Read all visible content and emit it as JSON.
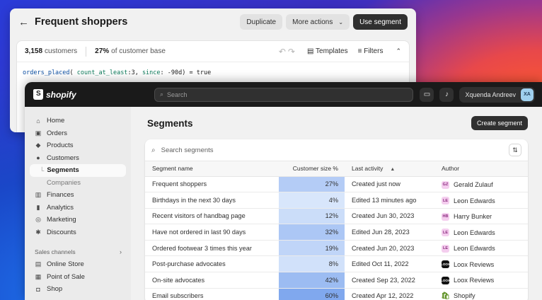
{
  "back_panel": {
    "title": "Frequent shoppers",
    "buttons": {
      "duplicate": "Duplicate",
      "more_actions": "More actions",
      "use_segment": "Use segment"
    },
    "stats": {
      "customers_count": "3,158",
      "customers_label": "customers",
      "percent": "27%",
      "percent_label": "of customer base"
    },
    "tools": {
      "templates": "Templates",
      "filters": "Filters"
    },
    "query": {
      "fn": "orders_placed",
      "arg1_key": "count_at_least",
      "arg1_val": "3",
      "arg2_key": "since",
      "arg2_val": "-90d",
      "op": "=",
      "value": "true"
    }
  },
  "topbar": {
    "brand": "shopify",
    "search_placeholder": "Search",
    "user_name": "Xquenda Andreev",
    "user_initials": "XA"
  },
  "sidebar": {
    "items": [
      {
        "label": "Home",
        "icon": "home-icon",
        "glyph": "⌂"
      },
      {
        "label": "Orders",
        "icon": "orders-icon",
        "glyph": "▣"
      },
      {
        "label": "Products",
        "icon": "tag-icon",
        "glyph": "◆"
      },
      {
        "label": "Customers",
        "icon": "person-icon",
        "glyph": "●"
      }
    ],
    "sub_items": [
      {
        "label": "Segments",
        "active": true
      },
      {
        "label": "Companies",
        "active": false
      }
    ],
    "items2": [
      {
        "label": "Finances",
        "icon": "bank-icon",
        "glyph": "▥"
      },
      {
        "label": "Analytics",
        "icon": "bar-chart-icon",
        "glyph": "▮"
      },
      {
        "label": "Marketing",
        "icon": "target-icon",
        "glyph": "◎"
      },
      {
        "label": "Discounts",
        "icon": "discount-icon",
        "glyph": "✱"
      }
    ],
    "section_label": "Sales channels",
    "channels": [
      {
        "label": "Online Store",
        "icon": "store-icon",
        "glyph": "▤"
      },
      {
        "label": "Point of Sale",
        "icon": "pos-icon",
        "glyph": "▦"
      },
      {
        "label": "Shop",
        "icon": "shop-icon",
        "glyph": "◘"
      }
    ]
  },
  "main": {
    "title": "Segments",
    "create_button": "Create segment",
    "search_placeholder": "Search segments",
    "columns": {
      "name": "Segment name",
      "size": "Customer size %",
      "activity": "Last activity",
      "author": "Author"
    },
    "rows": [
      {
        "name": "Frequent shoppers",
        "size": "27%",
        "size_value": 27,
        "activity": "Created just now",
        "author": "Gerald Zulauf",
        "badge": "GZ",
        "badge_style": "pink"
      },
      {
        "name": "Birthdays in the next 30 days",
        "size": "4%",
        "size_value": 4,
        "activity": "Edited 13 minutes ago",
        "author": "Leon Edwards",
        "badge": "LE",
        "badge_style": "pink"
      },
      {
        "name": "Recent visitors of handbag page",
        "size": "12%",
        "size_value": 12,
        "activity": "Created Jun 30, 2023",
        "author": "Harry Bunker",
        "badge": "HB",
        "badge_style": "pink"
      },
      {
        "name": "Have not ordered in last 90 days",
        "size": "32%",
        "size_value": 32,
        "activity": "Edited Jun 28, 2023",
        "author": "Leon Edwards",
        "badge": "LE",
        "badge_style": "pink"
      },
      {
        "name": "Ordered footwear 3 times this year",
        "size": "19%",
        "size_value": 19,
        "activity": "Created Jun 20, 2023",
        "author": "Leon Edwards",
        "badge": "LE",
        "badge_style": "pink"
      },
      {
        "name": "Post-purchase advocates",
        "size": "8%",
        "size_value": 8,
        "activity": "Edited Oct 11, 2022",
        "author": "Loox Reviews",
        "badge": "LOOX",
        "badge_style": "dark"
      },
      {
        "name": "On-site advocates",
        "size": "42%",
        "size_value": 42,
        "activity": "Created Sep 23, 2022",
        "author": "Loox Reviews",
        "badge": "LOOX",
        "badge_style": "dark"
      },
      {
        "name": "Email subscribers",
        "size": "60%",
        "size_value": 60,
        "activity": "Created Apr 12, 2022",
        "author": "Shopify",
        "badge": "🛍",
        "badge_style": "green"
      }
    ]
  }
}
